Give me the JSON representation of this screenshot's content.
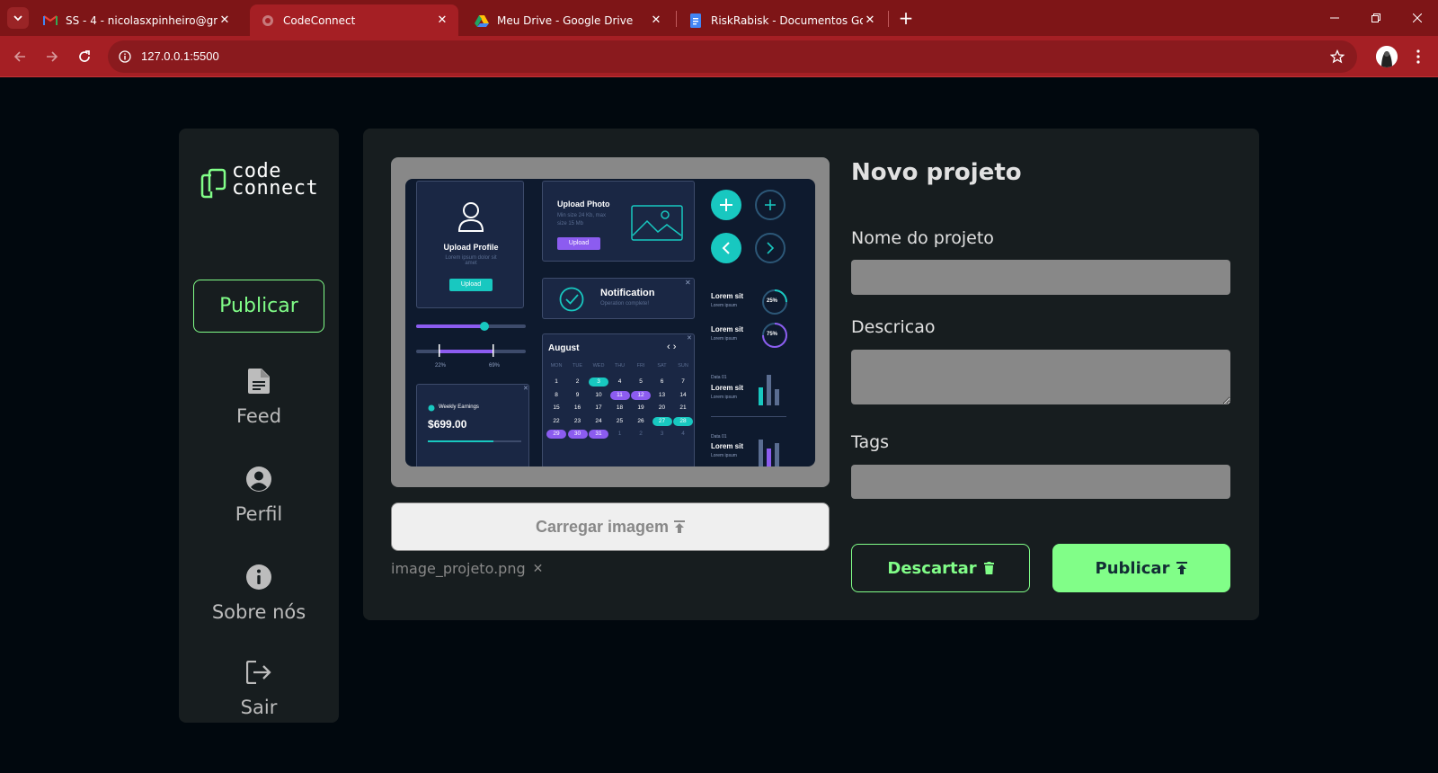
{
  "browser": {
    "tabs": [
      {
        "title": "SS - 4 - nicolasxpinheiro@gmail.com",
        "icon": "gmail-icon"
      },
      {
        "title": "CodeConnect",
        "icon": "globe-icon"
      },
      {
        "title": "Meu Drive - Google Drive",
        "icon": "google-drive-icon"
      },
      {
        "title": "RiskRabisk - Documentos Google",
        "icon": "google-docs-icon"
      }
    ],
    "url": "127.0.0.1:5500"
  },
  "sidebar": {
    "logo_line1": "code",
    "logo_line2": "connect",
    "publish_label": "Publicar",
    "nav": [
      {
        "label": "Feed",
        "icon": "document-icon"
      },
      {
        "label": "Perfil",
        "icon": "user-circle-icon"
      },
      {
        "label": "Sobre nós",
        "icon": "info-icon"
      },
      {
        "label": "Sair",
        "icon": "logout-icon"
      }
    ]
  },
  "project": {
    "upload_label": "Carregar imagem",
    "file_name": "image_projeto.png",
    "mockup": {
      "upload_profile": "Upload Profile",
      "upload_profile_text": "Lorem ipsum dolor sit amet",
      "upload_btn": "Upload",
      "upload_photo": "Upload Photo",
      "upload_photo_text": "Min size 24 Kb, max size 15 Mb",
      "notification": "Notification",
      "notification_sub": "Operation complete!",
      "slider_min": "22%",
      "slider_max": "69%",
      "weekly": "Weekly Earnings",
      "amount": "699.00",
      "month": "August",
      "weekdays": [
        "MON",
        "TUE",
        "WED",
        "THU",
        "FRI",
        "SAT",
        "SUN"
      ],
      "days": [
        "1",
        "2",
        "3",
        "4",
        "5",
        "6",
        "7",
        "8",
        "9",
        "10",
        "11",
        "12",
        "13",
        "14",
        "15",
        "16",
        "17",
        "18",
        "19",
        "20",
        "21",
        "22",
        "23",
        "24",
        "25",
        "26",
        "27",
        "28",
        "29",
        "30",
        "31",
        "1",
        "2",
        "3",
        "4"
      ],
      "lorem1": "Lorem sit",
      "lorem_sub": "Lorem ipsum",
      "pct1": "25%",
      "pct2": "75%",
      "data_label": "Data 01"
    }
  },
  "form": {
    "title": "Novo projeto",
    "name_label": "Nome do projeto",
    "description_label": "Descricao",
    "tags_label": "Tags",
    "discard_label": "Descartar",
    "publish_label": "Publicar"
  }
}
